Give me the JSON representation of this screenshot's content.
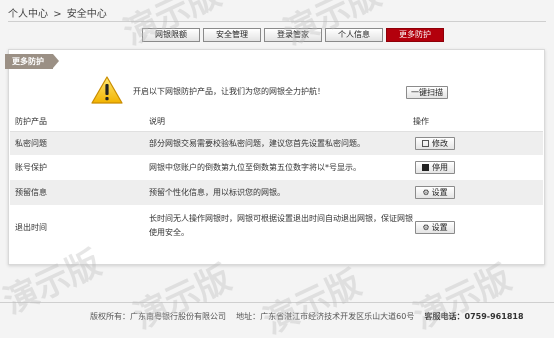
{
  "breadcrumb": {
    "home": "个人中心",
    "separator": ">",
    "current": "安全中心"
  },
  "tabs": [
    {
      "label": "网银限额",
      "active": false
    },
    {
      "label": "安全管理",
      "active": false
    },
    {
      "label": "登录管家",
      "active": false
    },
    {
      "label": "个人信息",
      "active": false
    },
    {
      "label": "更多防护",
      "active": true
    }
  ],
  "panel": {
    "ribbon": "更多防护",
    "notice": "开启以下网银防护产品，让我们为您的网银全力护航！",
    "scan_button": "一键扫描",
    "warn_icon": "warning-triangle-icon"
  },
  "table": {
    "headers": [
      "防护产品",
      "说明",
      "操作"
    ],
    "rows": [
      {
        "product": "私密问题",
        "desc": "部分网银交易需要校验私密问题，建议您首先设置私密问题。",
        "action": "修改",
        "icon": "edit-icon"
      },
      {
        "product": "账号保护",
        "desc": "网银中您账户的倒数第九位至倒数第五位数字将以*号显示。",
        "action": "停用",
        "icon": "stop-icon"
      },
      {
        "product": "预留信息",
        "desc": "预留个性化信息，用以标识您的网银。",
        "action": "设置",
        "icon": "gear-icon"
      },
      {
        "product": "退出时间",
        "desc1": "长时间无人操作网银时，网银可根据设置退出时间自动退出网银，保证网银",
        "desc2": "使用安全。",
        "action": "设置",
        "icon": "gear-icon"
      }
    ]
  },
  "footer": {
    "copyright": "版权所有：广东南粤银行股份有限公司",
    "address": "地址：广东省湛江市经济技术开发区乐山大道60号",
    "hotline_label": "客服电话：",
    "hotline": "0759-961818"
  },
  "watermark": "演示版",
  "colors": {
    "accent": "#b3000c",
    "ribbon": "#9b9085",
    "alt_row": "#eeeeee"
  }
}
